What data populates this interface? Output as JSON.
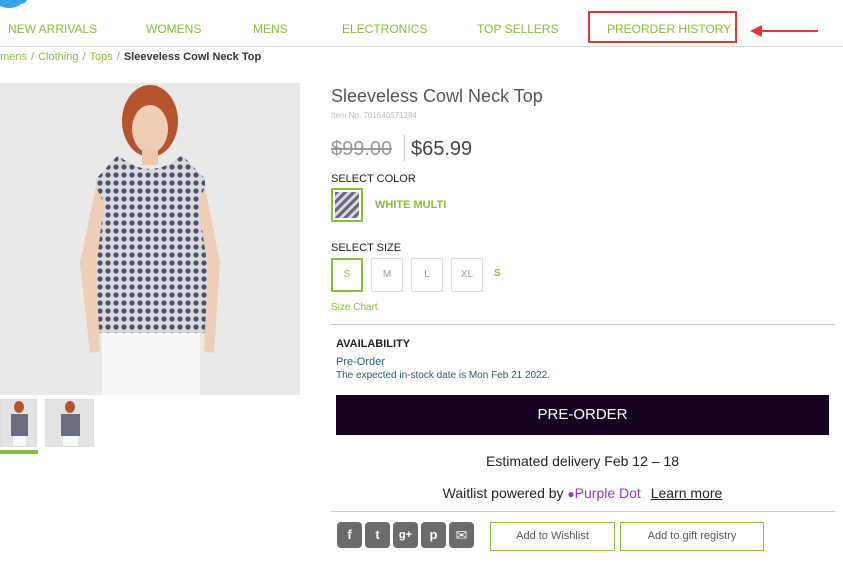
{
  "nav": {
    "items": [
      "NEW ARRIVALS",
      "WOMENS",
      "MENS",
      "ELECTRONICS",
      "TOP SELLERS",
      "PREORDER HISTORY"
    ]
  },
  "breadcrumb": {
    "items": [
      "omens",
      "Clothing",
      "Tops"
    ],
    "current": "Sleeveless Cowl Neck Top"
  },
  "product": {
    "title": "Sleeveless Cowl Neck Top",
    "item_no": "Item No. 701640571284",
    "old_price": "$99.00",
    "new_price": "$65.99",
    "select_color_label": "SELECT COLOR",
    "color_name": "WHITE MULTI",
    "select_size_label": "SELECT SIZE",
    "sizes": [
      "S",
      "M",
      "L",
      "XL"
    ],
    "selected_size": "S",
    "size_chart_label": "Size Chart"
  },
  "availability": {
    "title": "AVAILABILITY",
    "status": "Pre-Order",
    "date_text": "The expected in-stock date is Mon Feb 21 2022."
  },
  "actions": {
    "preorder_label": "PRE-ORDER",
    "delivery_text": "Estimated delivery Feb 12 – 18",
    "waitlist_prefix": "Waitlist powered by",
    "waitlist_brand": "Purple Dot",
    "learn_more": "Learn more",
    "wishlist_label": "Add to Wishlist",
    "registry_label": "Add to gift registry"
  },
  "social": {
    "icons": [
      "facebook-icon",
      "twitter-icon",
      "google-plus-icon",
      "pinterest-icon",
      "email-icon"
    ],
    "glyphs": [
      "f",
      "t",
      "g+",
      "p",
      "✉"
    ]
  },
  "colors": {
    "accent_green": "#8cbb3e",
    "highlight_red": "#e8343a",
    "button_dark": "#170321",
    "purple_dot": "#8f3bc4"
  }
}
